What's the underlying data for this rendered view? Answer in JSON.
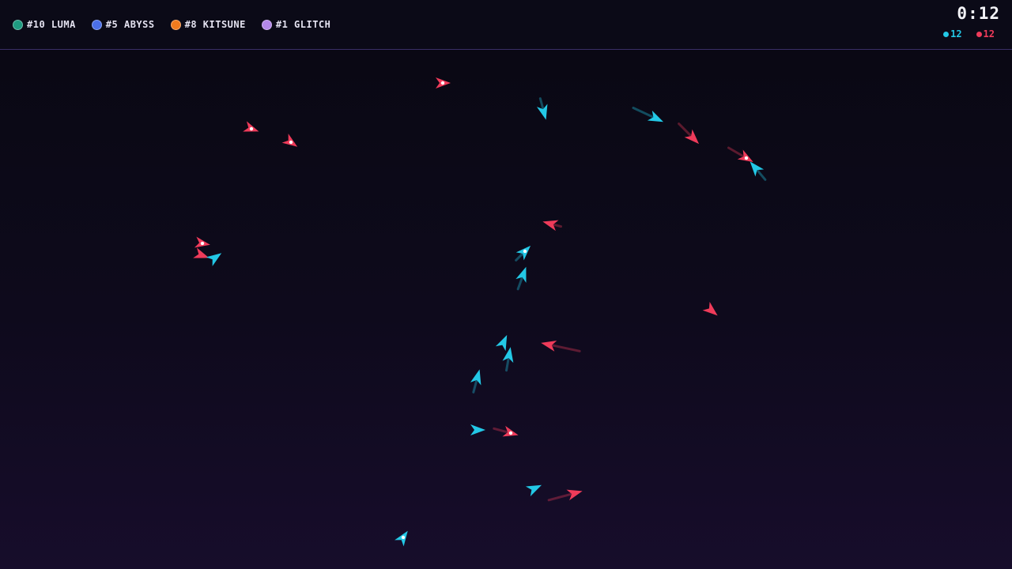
{
  "hud": {
    "players": [
      {
        "label": "#10 LUMA",
        "color": "#1f9a80"
      },
      {
        "label": "#5 ABYSS",
        "color": "#4b6fe8"
      },
      {
        "label": "#8 KITSUNE",
        "color": "#f07b1e"
      },
      {
        "label": "#1 GLITCH",
        "color": "#b388e8"
      }
    ],
    "timer": "0:12",
    "scores": {
      "cyan": {
        "value": "12",
        "color": "#23c8e6"
      },
      "red": {
        "value": "12",
        "color": "#ef3b5a"
      }
    }
  },
  "colors": {
    "cyan_team": "#23c8e6",
    "red_team": "#ef3b5a"
  }
}
